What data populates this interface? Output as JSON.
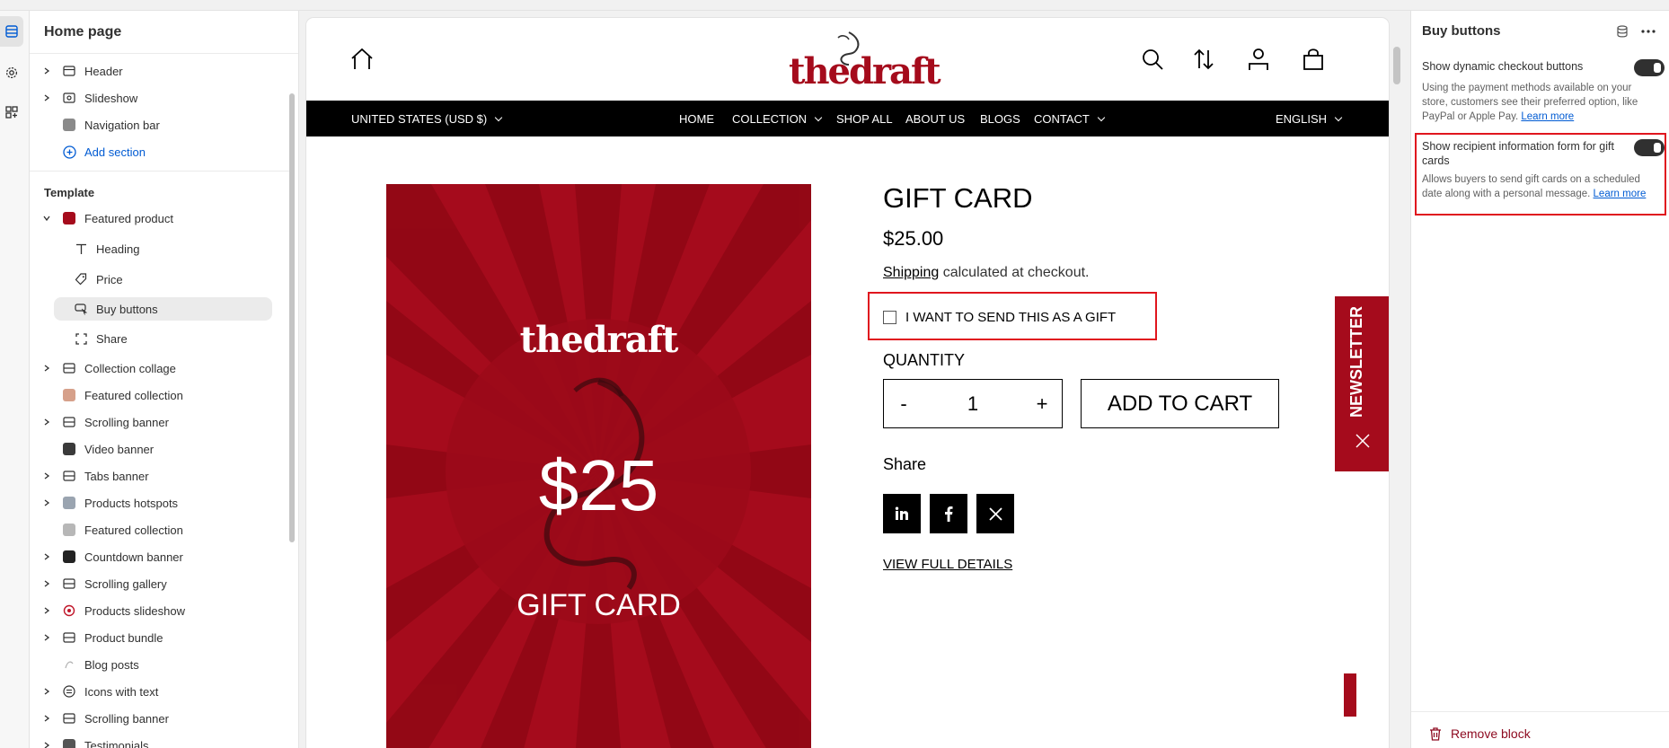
{
  "sidebar": {
    "title": "Home page",
    "items_top": [
      {
        "label": "Header",
        "expandable": true
      },
      {
        "label": "Slideshow",
        "expandable": true
      },
      {
        "label": "Navigation bar",
        "expandable": false
      }
    ],
    "add_section": "Add section",
    "template_heading": "Template",
    "featured_product": "Featured product",
    "children": [
      "Heading",
      "Price",
      "Buy buttons",
      "Share"
    ],
    "items_bottom": [
      {
        "label": "Collection collage",
        "expandable": true
      },
      {
        "label": "Featured collection",
        "expandable": false
      },
      {
        "label": "Scrolling banner",
        "expandable": true
      },
      {
        "label": "Video banner",
        "expandable": false
      },
      {
        "label": "Tabs banner",
        "expandable": true
      },
      {
        "label": "Products hotspots",
        "expandable": true
      },
      {
        "label": "Featured collection",
        "expandable": false
      },
      {
        "label": "Countdown banner",
        "expandable": true
      },
      {
        "label": "Scrolling gallery",
        "expandable": true
      },
      {
        "label": "Products slideshow",
        "expandable": true
      },
      {
        "label": "Product bundle",
        "expandable": true
      },
      {
        "label": "Blog posts",
        "expandable": false
      },
      {
        "label": "Icons with text",
        "expandable": true
      },
      {
        "label": "Scrolling banner",
        "expandable": true
      },
      {
        "label": "Testimonials",
        "expandable": true
      }
    ]
  },
  "store": {
    "logo": "thedraft",
    "currency": "UNITED STATES (USD $)",
    "nav": [
      "HOME",
      "COLLECTION",
      "SHOP ALL",
      "ABOUT US",
      "BLOGS",
      "CONTACT"
    ],
    "language": "ENGLISH"
  },
  "product": {
    "image_brand": "thedraft",
    "image_price": "$25",
    "image_label": "GIFT CARD",
    "title": "GIFT CARD",
    "price": "$25.00",
    "shipping_link": "Shipping",
    "shipping_rest": " calculated at checkout.",
    "gift_checkbox": "I WANT TO SEND THIS AS A GIFT",
    "quantity_label": "QUANTITY",
    "minus": "-",
    "quantity": "1",
    "plus": "+",
    "add_to_cart": "ADD TO CART",
    "share_label": "Share",
    "view_details": "VIEW FULL DETAILS",
    "newsletter": "NEWSLETTER"
  },
  "panel": {
    "title": "Buy buttons",
    "setting1_label": "Show dynamic checkout buttons",
    "setting1_help": "Using the payment methods available on your store, customers see their preferred option, like PayPal or Apple Pay.",
    "setting2_label": "Show recipient information form for gift cards",
    "setting2_help": "Allows buyers to send gift cards on a scheduled date along with a personal message.",
    "learn_more": "Learn more",
    "remove_block": "Remove block"
  },
  "colors": {
    "brand_red": "#a50b1c",
    "highlight": "#e0161e",
    "link": "#005bd3"
  }
}
